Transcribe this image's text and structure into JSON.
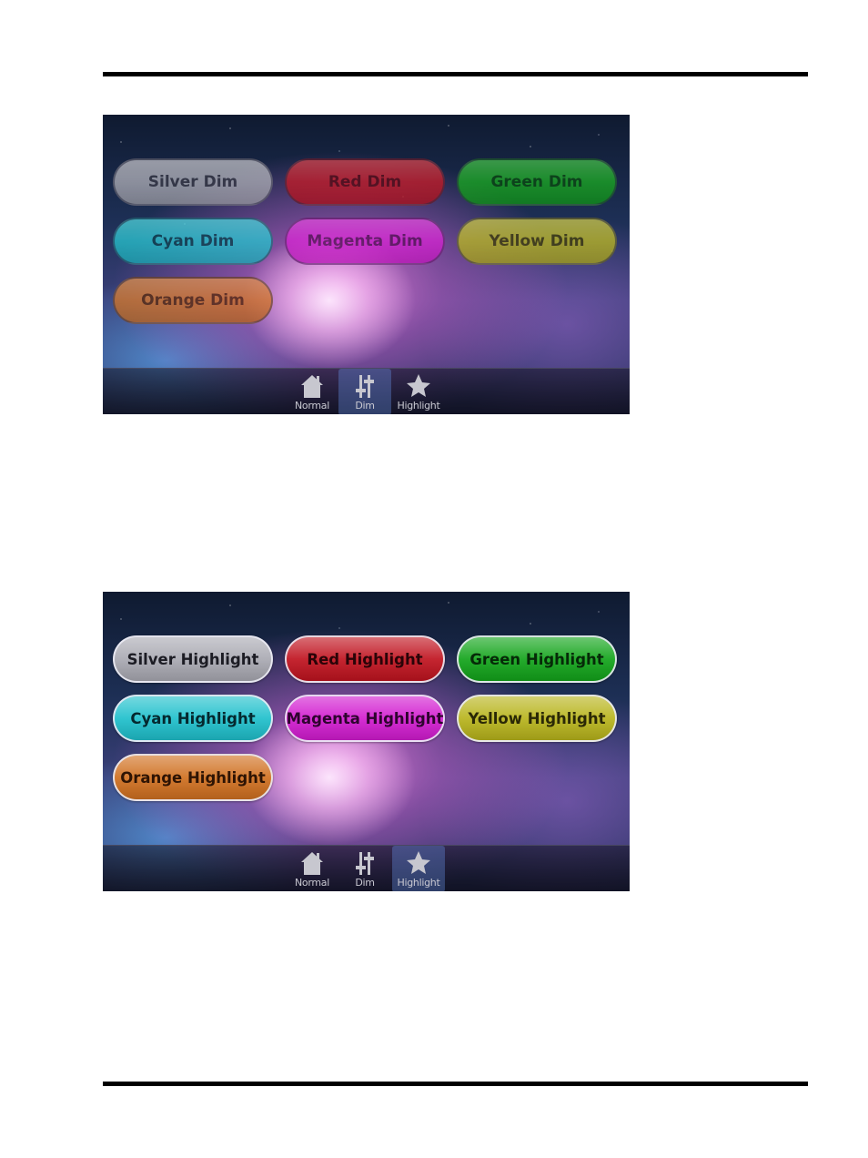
{
  "screens": [
    {
      "active_tab": "Dim",
      "buttons": [
        "Silver Dim",
        "Red Dim",
        "Green Dim",
        "Cyan Dim",
        "Magenta Dim",
        "Yellow Dim",
        "Orange Dim"
      ]
    },
    {
      "active_tab": "Highlight",
      "buttons": [
        "Silver Highlight",
        "Red Highlight",
        "Green Highlight",
        "Cyan Highlight",
        "Magenta Highlight",
        "Yellow Highlight",
        "Orange Highlight"
      ]
    }
  ],
  "tabs": [
    {
      "label": "Normal",
      "icon": "home-icon"
    },
    {
      "label": "Dim",
      "icon": "sliders-icon"
    },
    {
      "label": "Highlight",
      "icon": "star-icon"
    }
  ],
  "colors": {
    "silver": "#a9a9b2",
    "red": "#c0131f",
    "green": "#12a41a",
    "cyan": "#1fc0cc",
    "magenta": "#d21cd0",
    "yellow": "#b8b41c",
    "orange": "#d07020"
  }
}
